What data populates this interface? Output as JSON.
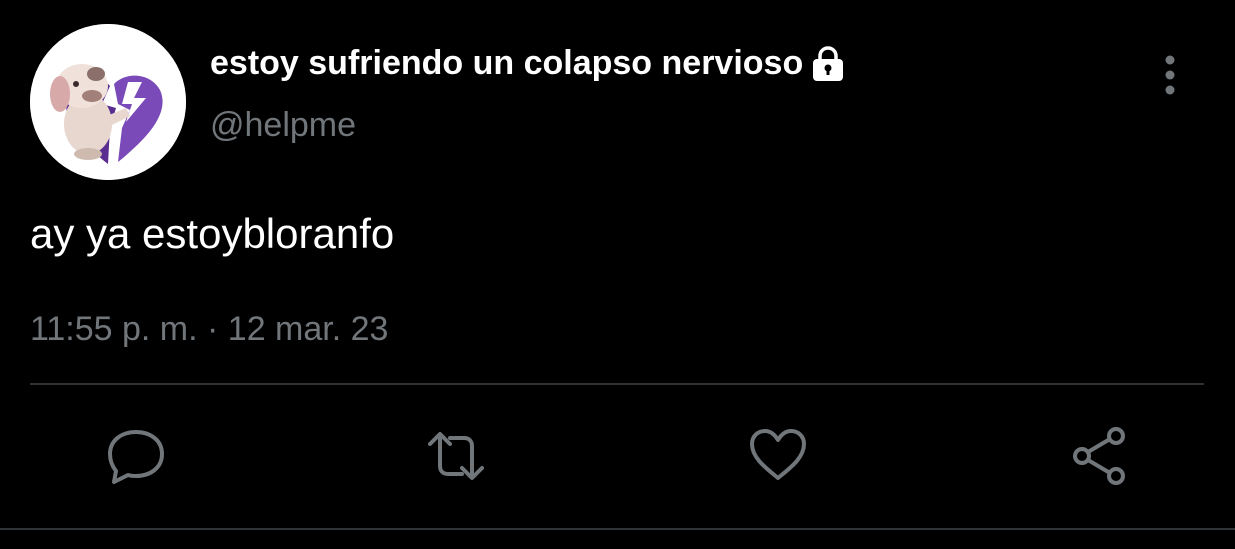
{
  "tweet": {
    "display_name": "estoy sufriendo un colapso nervioso",
    "handle": "@helpme",
    "text": "ay ya estoybloranfo",
    "timestamp": "11:55 p. m. · 12 mar. 23",
    "protected_icon": "lock-icon",
    "avatar_image": "cartoon-dog-broken-heart"
  },
  "actions": {
    "reply_icon": "reply-icon",
    "retweet_icon": "retweet-icon",
    "like_icon": "heart-icon",
    "share_icon": "share-icon",
    "more_icon": "more-vertical-icon"
  },
  "colors": {
    "background": "#000000",
    "primary_text": "#ffffff",
    "secondary_text": "#71767b",
    "divider": "#2f3336",
    "avatar_heart": "#6b3fa0"
  }
}
